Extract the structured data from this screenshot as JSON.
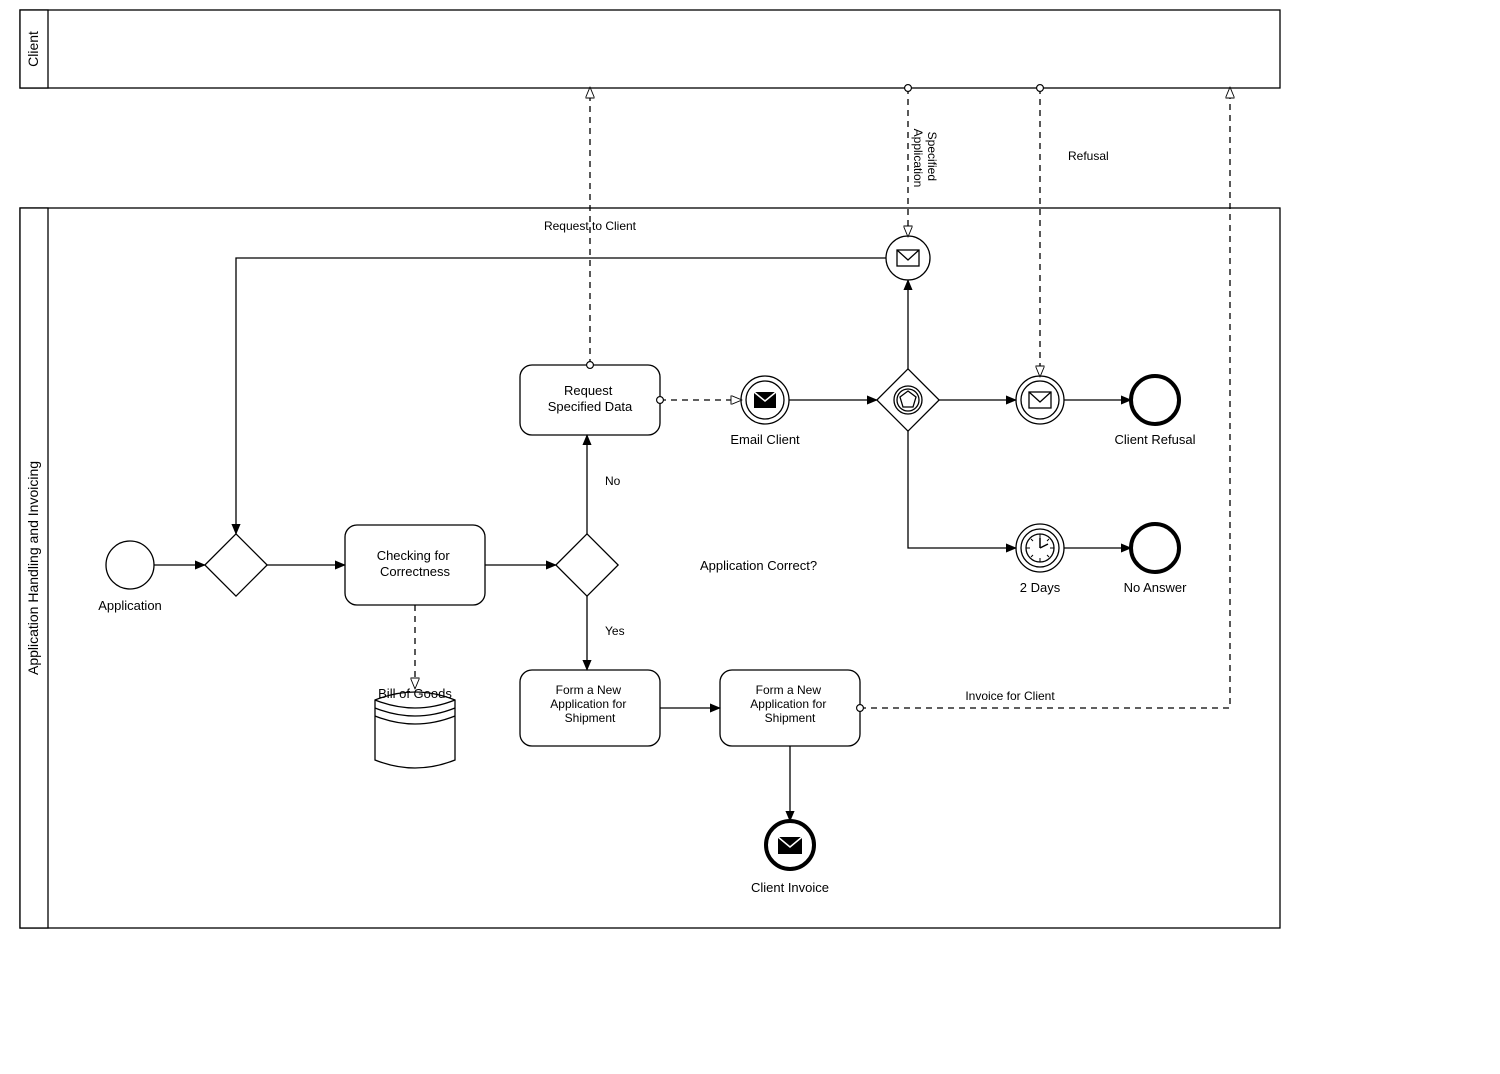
{
  "pools": {
    "client_label": "Client",
    "process_label": "Application Handling and Invoicing"
  },
  "nodes": {
    "start_label": "Application",
    "check_task": "Checking for\nCorrectness",
    "datastore_label": "Bill of Goods",
    "gateway_question": "Application Correct?",
    "gateway_no": "No",
    "gateway_yes": "Yes",
    "request_task": "Request\nSpecified Data",
    "email_event_label": "Email Client",
    "refusal_event_label": "Client Refusal",
    "timer_event_label": "2 Days",
    "noanswer_label": "No Answer",
    "form1_task": "Form a New\nApplication for\nShipment",
    "form2_task": "Form a New\nApplication for\nShipment",
    "client_invoice_label": "Client Invoice"
  },
  "messages": {
    "request_to_client": "Request to Client",
    "specified_application": "Specified\nApplication",
    "refusal": "Refusal",
    "invoice_for_client": "Invoice for Client"
  }
}
